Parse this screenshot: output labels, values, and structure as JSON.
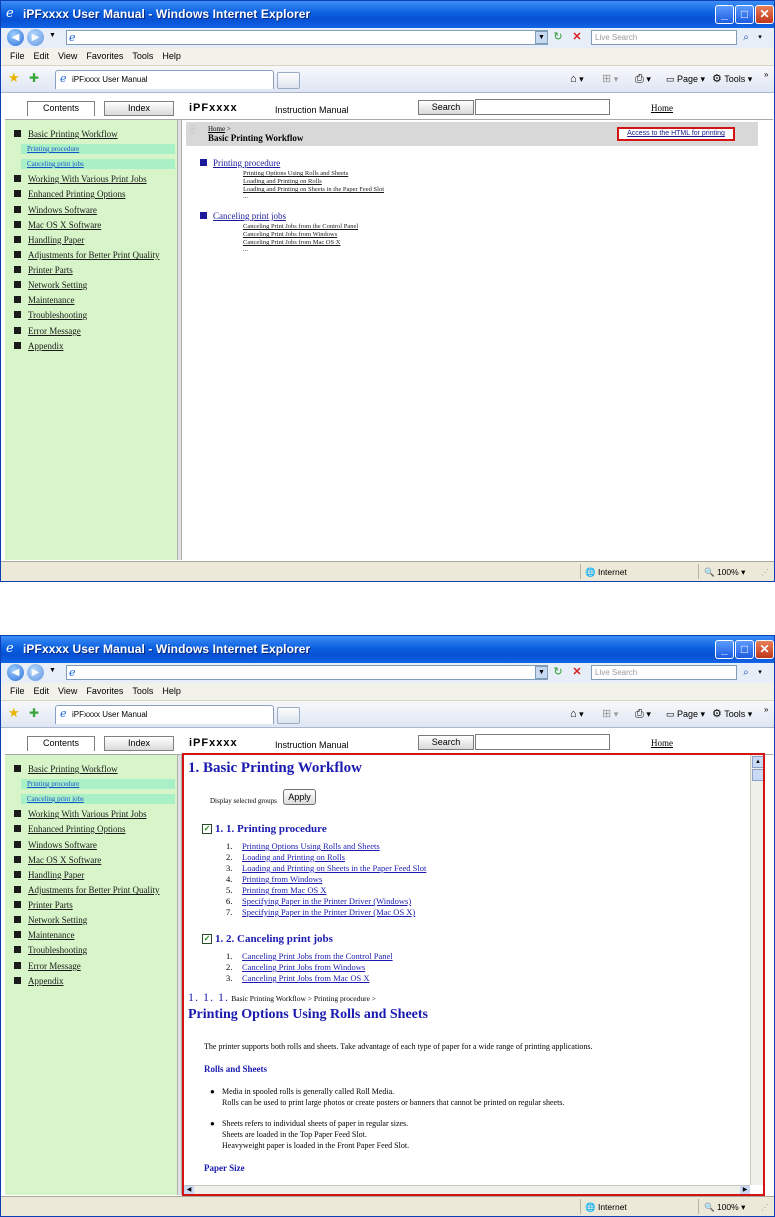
{
  "window": {
    "title": "iPFxxxx User Manual - Windows Internet Explorer",
    "search_placeholder": "Live Search",
    "menu": [
      "File",
      "Edit",
      "View",
      "Favorites",
      "Tools",
      "Help"
    ],
    "tab_title": "iPFxxxx User Manual",
    "page_label": "Page",
    "tools_label": "Tools",
    "status_zone": "Internet",
    "zoom": "100%"
  },
  "manual": {
    "contents_tab": "Contents",
    "index_tab": "Index",
    "brand": "iPFxxxx",
    "brand_subtitle": "Instruction Manual",
    "search_button": "Search",
    "home_link": "Home"
  },
  "sidebar": {
    "items": [
      "Basic Printing Workflow",
      "Working With Various Print Jobs",
      "Enhanced Printing Options",
      "Windows Software",
      "Mac OS X Software",
      "Handling Paper",
      "Adjustments for Better Print Quality",
      "Printer Parts",
      "Network Setting",
      "Maintenance",
      "Troubleshooting",
      "Error Message",
      "Appendix"
    ],
    "subitems": [
      "Printing procedure",
      "Canceling print jobs"
    ]
  },
  "page1": {
    "breadcrumb_home": "Home",
    "breadcrumb_sep": ">",
    "page_title": "Basic Printing Workflow",
    "print_link": "Access to the HTML for printing",
    "sections": [
      {
        "title": "Printing procedure",
        "links": [
          "Printing Options Using Rolls and Sheets",
          "Loading and Printing on Rolls",
          "Loading and Printing on Sheets in the Paper Feed Slot"
        ],
        "more": "..."
      },
      {
        "title": "Canceling print jobs",
        "links": [
          "Canceling Print Jobs from the Control Panel",
          "Canceling Print Jobs from Windows",
          "Canceling Print Jobs from Mac OS X"
        ],
        "more": "..."
      }
    ]
  },
  "page2": {
    "heading": "1. Basic Printing Workflow",
    "display_selected": "Display selected groups",
    "apply_button": "Apply",
    "groups": [
      {
        "title": "1. 1. Printing procedure",
        "items": [
          "Printing Options Using Rolls and Sheets",
          "Loading and Printing on Rolls",
          "Loading and Printing on Sheets in the Paper Feed Slot",
          "Printing from Windows",
          "Printing from Mac OS X",
          "Specifying Paper in the Printer Driver (Windows)",
          "Specifying Paper in the Printer Driver (Mac OS X)"
        ]
      },
      {
        "title": "1. 2. Canceling print jobs",
        "items": [
          "Canceling Print Jobs from the Control Panel",
          "Canceling Print Jobs from Windows",
          "Canceling Print Jobs from Mac OS X"
        ]
      }
    ],
    "section_number": "1. 1. 1.",
    "section_breadcrumb": "Basic Printing Workflow > Printing procedure >",
    "section_title": "Printing Options Using Rolls and Sheets",
    "intro": "The printer supports both rolls and sheets. Take advantage of each type of paper for a wide range of printing applications.",
    "rolls_heading": "Rolls and Sheets",
    "bullet1_line1": "Media in spooled rolls is generally called Roll Media.",
    "bullet1_line2": "Rolls can be used to print large photos or create posters or banners that cannot be printed on regular sheets.",
    "bullet2_line1": "Sheets refers to individual sheets of paper in regular sizes.",
    "bullet2_line2": "Sheets are loaded in the Top Paper Feed Slot.",
    "bullet2_line3": "Heavyweight paper is loaded in the Front Paper Feed Slot.",
    "paper_size_heading": "Paper Size"
  }
}
